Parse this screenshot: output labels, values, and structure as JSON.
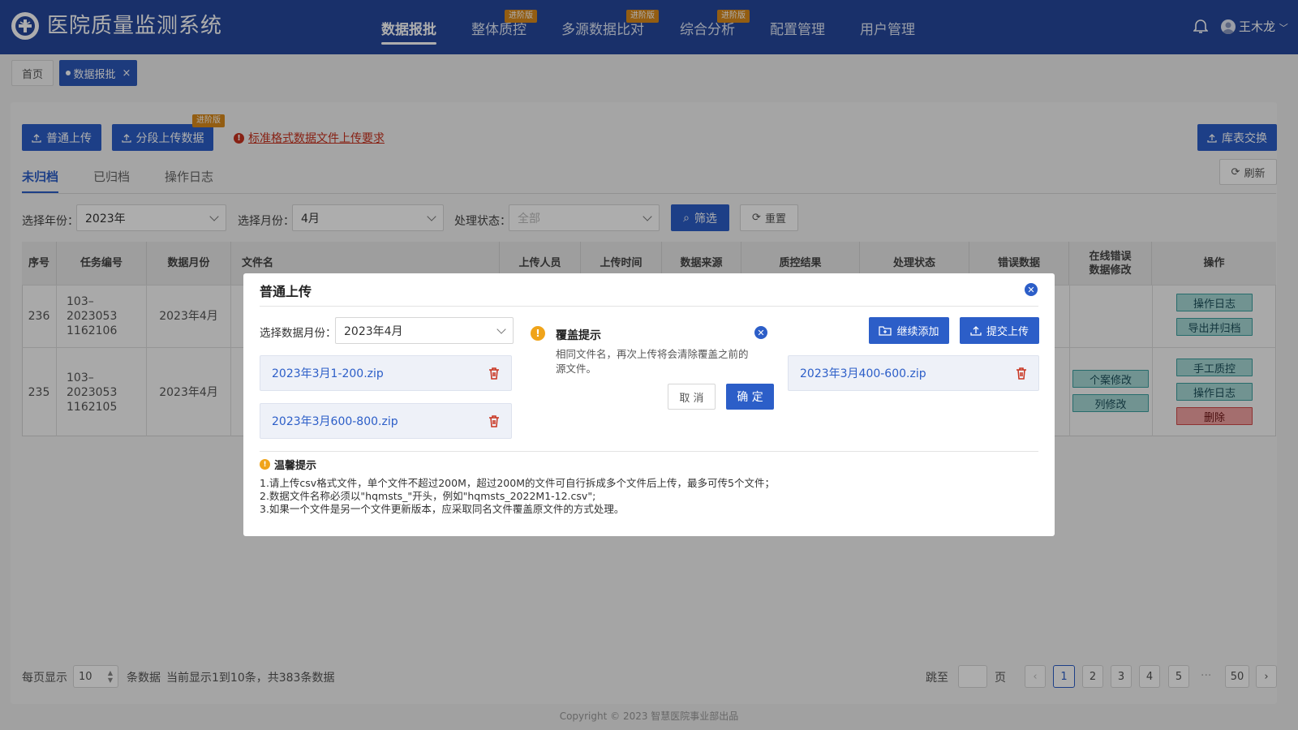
{
  "app": {
    "title": "医院质量监测系统",
    "user": "王木龙"
  },
  "nav": [
    {
      "label": "数据报批",
      "badge": ""
    },
    {
      "label": "整体质控",
      "badge": "进阶版"
    },
    {
      "label": "多源数据比对",
      "badge": "进阶版"
    },
    {
      "label": "综合分析",
      "badge": "进阶版"
    },
    {
      "label": "配置管理",
      "badge": ""
    },
    {
      "label": "用户管理",
      "badge": ""
    }
  ],
  "tabs": {
    "home": "首页",
    "current": "数据报批",
    "close": "×"
  },
  "toolbar": {
    "upload": "普通上传",
    "segment_upload": "分段上传数据",
    "segment_badge": "进阶版",
    "requirements_link": "标准格式数据文件上传要求",
    "exchange": "库表交换",
    "refresh": "刷新"
  },
  "subtabs": [
    "未归档",
    "已归档",
    "操作日志"
  ],
  "filters": {
    "year_label": "选择年份：",
    "year_value": "2023年",
    "month_label": "选择月份：",
    "month_value": "4月",
    "status_label": "处理状态：",
    "status_value": "全部",
    "filter_btn": "筛选",
    "reset_btn": "重置"
  },
  "table": {
    "headers": [
      "序号",
      "任务编号",
      "数据月份",
      "文件名",
      "上传人员",
      "上传时间",
      "数据来源",
      "质控结果",
      "处理状态",
      "错误数据",
      "在线错误数据修改",
      "操作"
    ],
    "rows": [
      {
        "seq": "236",
        "task": "103–2023053 1162106",
        "month": "2023年4月",
        "edits": [],
        "ops": [
          "操作日志",
          "导出并归档"
        ]
      },
      {
        "seq": "235",
        "task": "103–2023053 1162105",
        "month": "2023年4月",
        "edits": [
          "个案修改",
          "列修改"
        ],
        "ops": [
          "手工质控",
          "操作日志",
          "删除"
        ]
      }
    ]
  },
  "pagination": {
    "per_page_label": "每页显示",
    "per_page_value": "10",
    "unit": "条数据",
    "summary": "当前显示1到10条，共383条数据",
    "jump_label": "跳至",
    "page_label": "页",
    "pages": [
      "1",
      "2",
      "3",
      "4",
      "5"
    ],
    "ellipsis": "···",
    "last": "50",
    "current": "1"
  },
  "copyright": "Copyright © 2023 智慧医院事业部出品",
  "modal": {
    "title": "普通上传",
    "month_label": "选择数据月份：",
    "month_value": "2023年4月",
    "left_files": [
      "2023年3月1-200.zip",
      "2023年3月600-800.zip"
    ],
    "right_files": [
      "2023年3月400-600.zip"
    ],
    "continue_add": "继续添加",
    "submit_upload": "提交上传",
    "tip_title": "温馨提示",
    "tips": [
      "1.请上传csv格式文件，单个文件不超过200M，超过200M的文件可自行拆成多个文件后上传，最多可传5个文件；",
      "2.数据文件名称必须以\"hqmsts_\"开头，例如\"hqmsts_2022M1-12.csv\";",
      "3.如果一个文件是另一个文件更新版本，应采取同名文件覆盖原文件的方式处理。"
    ]
  },
  "popover": {
    "title": "覆盖提示",
    "line1": "相同文件名，再次上传将会清除覆盖之前的",
    "line2": "源文件。",
    "cancel": "取 消",
    "confirm": "确 定"
  },
  "colors": {
    "header": "#26489c",
    "primary": "#2c5ec8",
    "danger": "#c8321e",
    "badge": "#d98a1b"
  }
}
